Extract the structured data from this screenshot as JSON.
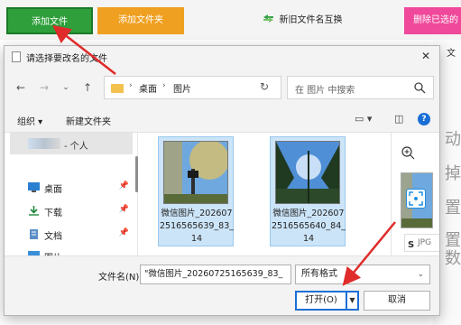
{
  "toolbar": {
    "add_file": "添加文件",
    "add_folder": "添加文件夹",
    "swap_names": "新旧文件名互换",
    "delete_selected": "删除已选的",
    "add_file_color": "#2e9f3b",
    "add_folder_color": "#f0a020",
    "delete_color": "#f0489a"
  },
  "background_right": {
    "glyph1": "动",
    "glyph2": "掉",
    "glyph3": "置",
    "glyph4": "置",
    "glyph5": "数",
    "top_char": "文"
  },
  "dialog": {
    "title": "请选择要改名的文件",
    "breadcrumb": [
      "桌面",
      "图片"
    ],
    "search_placeholder": "在 图片 中搜索",
    "organize": "组织 ▾",
    "new_folder": "新建文件夹",
    "sidebar": {
      "user_suffix": "- 个人",
      "items": [
        {
          "label": "桌面",
          "icon": "desktop-icon"
        },
        {
          "label": "下载",
          "icon": "download-icon"
        },
        {
          "label": "文档",
          "icon": "document-icon"
        },
        {
          "label": "图片",
          "icon": "pictures-icon"
        }
      ]
    },
    "files": [
      {
        "name": "微信图片_2026072516565639_83_14",
        "selected": true
      },
      {
        "name": "微信图片_2026072516565640_84_14",
        "selected": true
      }
    ],
    "preview": {
      "jpg_label": "JPG"
    },
    "filename_label": "文件名(N):",
    "filename_value": "\"微信图片_20260725165639_83_",
    "filetype": "所有格式",
    "open_button": "打开(O)",
    "cancel_button": "取消",
    "accent_color": "#1a6fd6"
  }
}
